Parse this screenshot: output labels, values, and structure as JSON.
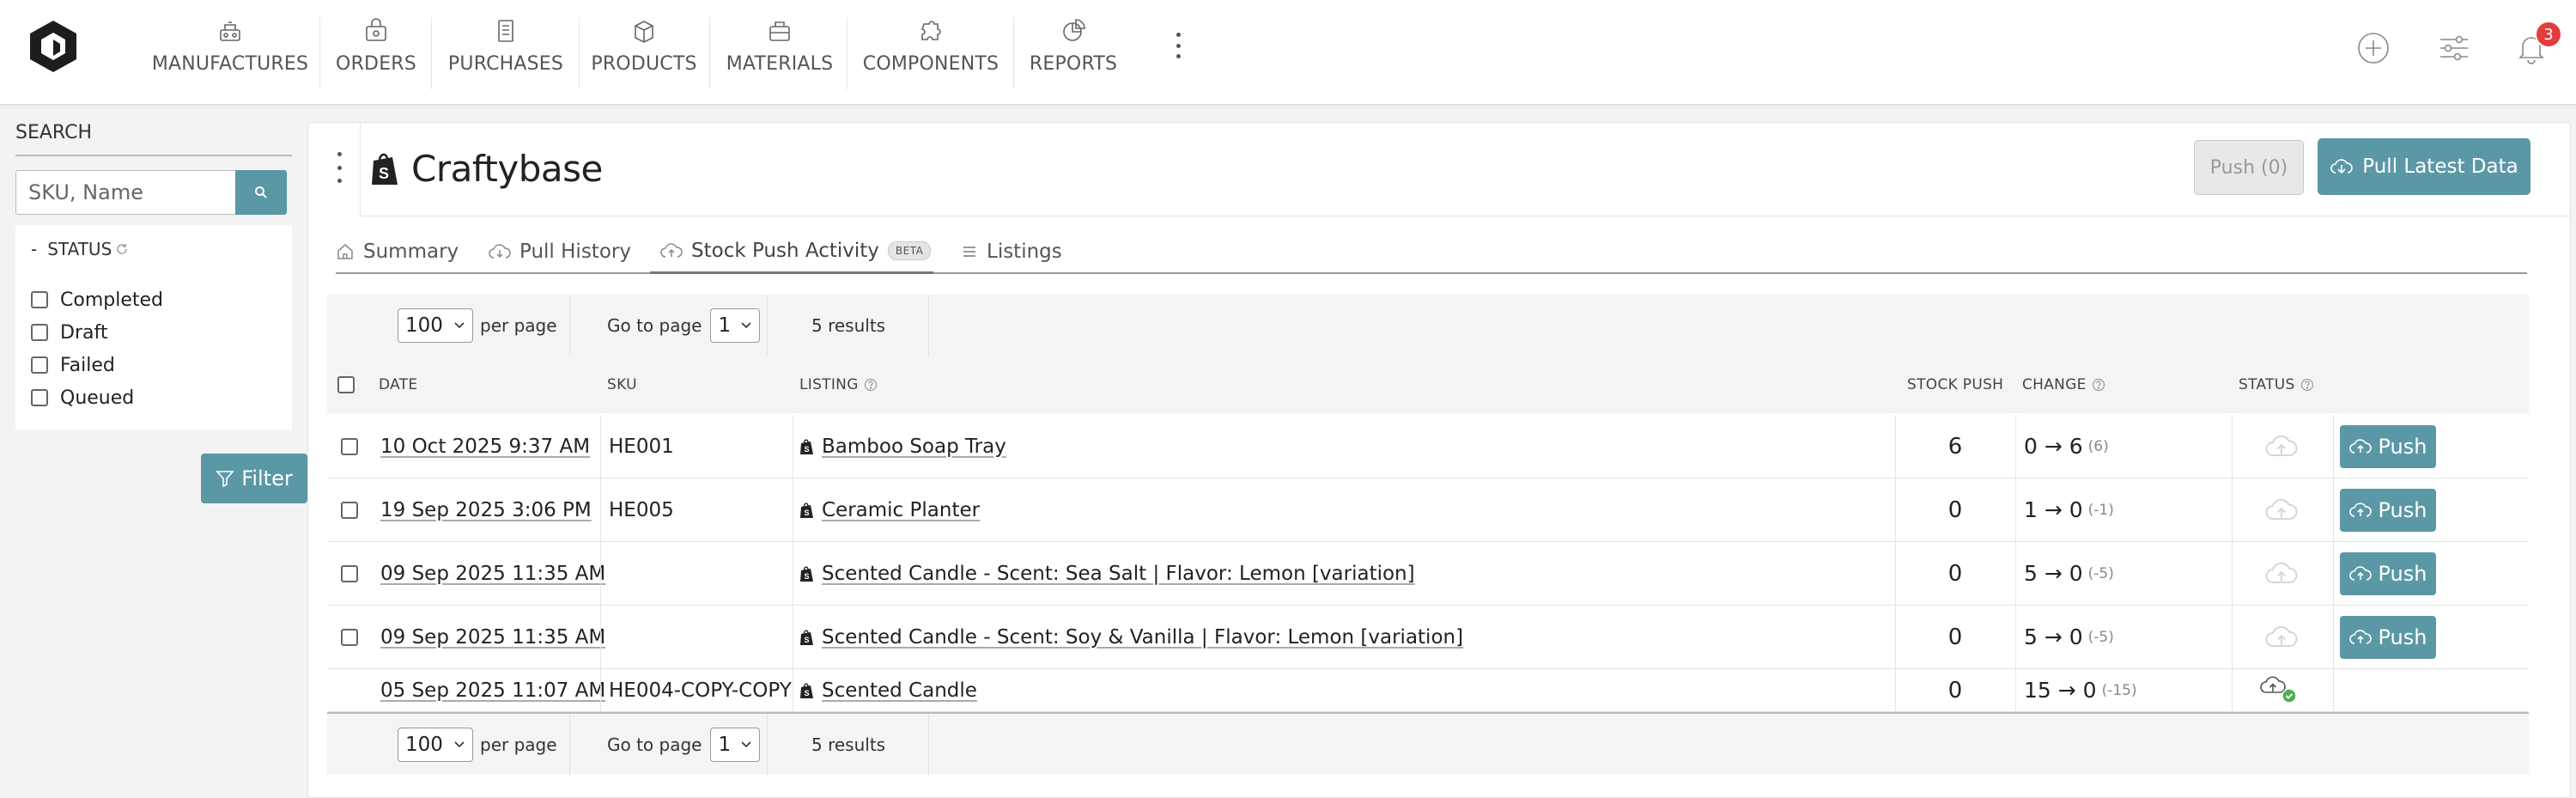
{
  "nav": {
    "items": [
      {
        "label": "MANUFACTURES",
        "icon": "manufactures-icon"
      },
      {
        "label": "ORDERS",
        "icon": "orders-icon"
      },
      {
        "label": "PURCHASES",
        "icon": "purchases-icon"
      },
      {
        "label": "PRODUCTS",
        "icon": "products-icon"
      },
      {
        "label": "MATERIALS",
        "icon": "materials-icon"
      },
      {
        "label": "COMPONENTS",
        "icon": "components-icon"
      },
      {
        "label": "REPORTS",
        "icon": "reports-icon"
      }
    ],
    "notification_count": "3"
  },
  "sidebar": {
    "search_title": "SEARCH",
    "search_placeholder": "SKU, Name",
    "status_toggle": "-",
    "status_label": "STATUS",
    "status_options": [
      "Completed",
      "Draft",
      "Failed",
      "Queued"
    ],
    "filter_label": "Filter"
  },
  "panel": {
    "title": "Craftybase",
    "push_label": "Push (0)",
    "pull_label": "Pull Latest Data",
    "tabs": [
      {
        "label": "Summary",
        "icon": "home-icon"
      },
      {
        "label": "Pull History",
        "icon": "cloud-download-icon"
      },
      {
        "label": "Stock Push Activity",
        "icon": "cloud-upload-icon",
        "badge": "BETA",
        "active": true
      },
      {
        "label": "Listings",
        "icon": "list-icon"
      }
    ]
  },
  "pager": {
    "per_page_value": "100",
    "per_page_label": "per page",
    "goto_label": "Go to page",
    "page_value": "1",
    "results": "5 results"
  },
  "table": {
    "columns": {
      "date": "DATE",
      "sku": "SKU",
      "listing": "LISTING",
      "stock_push": "STOCK PUSH",
      "change": "CHANGE",
      "status": "STATUS"
    },
    "push_button": "Push",
    "rows": [
      {
        "date": "10 Oct 2025 9:37 AM",
        "sku": "HE001",
        "listing": "Bamboo Soap Tray",
        "stock_push": "6",
        "change": "0 → 6",
        "delta": "(6)",
        "has_checkbox": true,
        "status": "pending",
        "has_push": true
      },
      {
        "date": "19 Sep 2025 3:06 PM",
        "sku": "HE005",
        "listing": "Ceramic Planter",
        "stock_push": "0",
        "change": "1 → 0",
        "delta": "(-1)",
        "has_checkbox": true,
        "status": "pending",
        "has_push": true
      },
      {
        "date": "09 Sep 2025 11:35 AM",
        "sku": "",
        "listing": "Scented Candle - Scent: Sea Salt | Flavor: Lemon [variation]",
        "stock_push": "0",
        "change": "5 → 0",
        "delta": "(-5)",
        "has_checkbox": true,
        "status": "pending",
        "has_push": true
      },
      {
        "date": "09 Sep 2025 11:35 AM",
        "sku": "",
        "listing": "Scented Candle - Scent: Soy & Vanilla | Flavor: Lemon [variation]",
        "stock_push": "0",
        "change": "5 → 0",
        "delta": "(-5)",
        "has_checkbox": true,
        "status": "pending",
        "has_push": true
      },
      {
        "date": "05 Sep 2025 11:07 AM",
        "sku": "HE004-COPY-COPY",
        "listing": "Scented Candle",
        "stock_push": "0",
        "change": "15 → 0",
        "delta": "(-15)",
        "has_checkbox": false,
        "status": "completed",
        "has_push": false
      }
    ]
  },
  "colors": {
    "accent": "#5b98a6",
    "badge": "#e23d3d",
    "success": "#4caf50"
  }
}
